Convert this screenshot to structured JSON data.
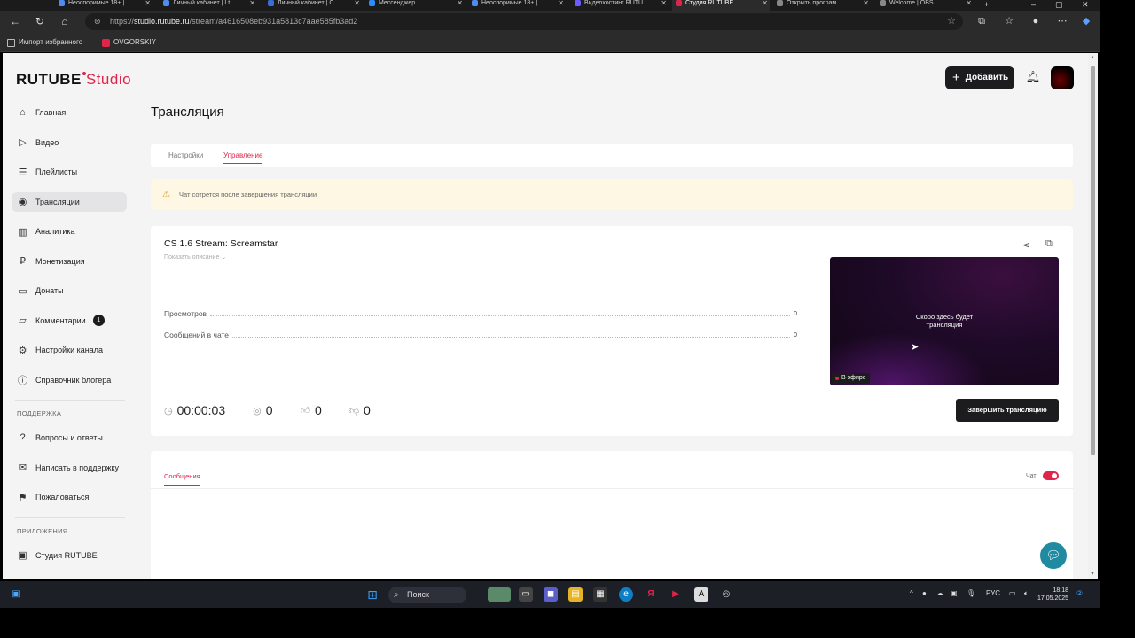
{
  "browser": {
    "tabs": [
      {
        "label": "Неоспоримые 18+ |",
        "color": "#4e8cf0"
      },
      {
        "label": "Личный кабинет | Lt",
        "color": "#4e8cf0"
      },
      {
        "label": "Личный кабинет | С",
        "color": "#3b6fd6"
      },
      {
        "label": "Мессенджер",
        "color": "#2a8cff"
      },
      {
        "label": "Неоспоримые 18+ |",
        "color": "#4e8cf0"
      },
      {
        "label": "Видеохостинг RUTU",
        "color": "#6a5cff"
      },
      {
        "label": "Студия RUTUBE",
        "color": "#e0244a"
      },
      {
        "label": "Открыть програм",
        "color": "#888888"
      },
      {
        "label": "Welcome | OBS",
        "color": "#888888"
      }
    ],
    "url_prefix": "https://",
    "url_host": "studio.rutube.ru",
    "url_path": "/stream/a4616508eb931a5813c7aae585fb3ad2",
    "bookmarks": [
      {
        "label": "Импорт избранного"
      },
      {
        "label": "OVGORSKIY"
      }
    ]
  },
  "header": {
    "logo_main": "RUTUBE",
    "logo_studio": "Studio",
    "add_label": "Добавить"
  },
  "sidebar": {
    "items": [
      {
        "label": "Главная",
        "icon": "home-icon"
      },
      {
        "label": "Видео",
        "icon": "video-icon"
      },
      {
        "label": "Плейлисты",
        "icon": "playlist-icon"
      },
      {
        "label": "Трансляции",
        "icon": "broadcast-icon"
      },
      {
        "label": "Аналитика",
        "icon": "analytics-icon"
      },
      {
        "label": "Монетизация",
        "icon": "monetization-icon"
      },
      {
        "label": "Донаты",
        "icon": "donate-icon"
      },
      {
        "label": "Комментарии",
        "icon": "comment-icon",
        "badge": "1"
      },
      {
        "label": "Настройки канала",
        "icon": "gear-icon"
      },
      {
        "label": "Справочник блогера",
        "icon": "info-icon"
      }
    ],
    "support_heading": "ПОДДЕРЖКА",
    "support_items": [
      {
        "label": "Вопросы и ответы",
        "icon": "question-icon"
      },
      {
        "label": "Написать в поддержку",
        "icon": "mail-icon"
      },
      {
        "label": "Пожаловаться",
        "icon": "flag-icon"
      }
    ],
    "apps_heading": "ПРИЛОЖЕНИЯ",
    "apps_items": [
      {
        "label": "Студия RUTUBE",
        "icon": "app-icon"
      }
    ]
  },
  "main": {
    "title": "Трансляция",
    "tabs": [
      {
        "label": "Настройки"
      },
      {
        "label": "Управление"
      }
    ],
    "notice": "Чат сотрется после завершения трансляции",
    "stream": {
      "title": "CS 1.6 Stream: Screamstar",
      "show_description": "Показать описание",
      "stats": [
        {
          "label": "Просмотров",
          "value": "0"
        },
        {
          "label": "Сообщений в чате",
          "value": "0"
        }
      ],
      "duration": "00:00:03",
      "viewers": "0",
      "likes": "0",
      "dislikes": "0",
      "preview_text_line1": "Скоро здесь будет",
      "preview_text_line2": "трансляция",
      "live_badge": "В эфире",
      "end_button": "Завершить трансляцию"
    },
    "messages": {
      "tab_label": "Сообщения",
      "chat_label": "Чат",
      "chat_enabled": true
    }
  },
  "taskbar": {
    "search_label": "Поиск",
    "lang": "РУС",
    "time": "18:18",
    "date": "17.05.2025"
  },
  "colors": {
    "accent": "#e0244a",
    "dark": "#1c1c1e"
  }
}
